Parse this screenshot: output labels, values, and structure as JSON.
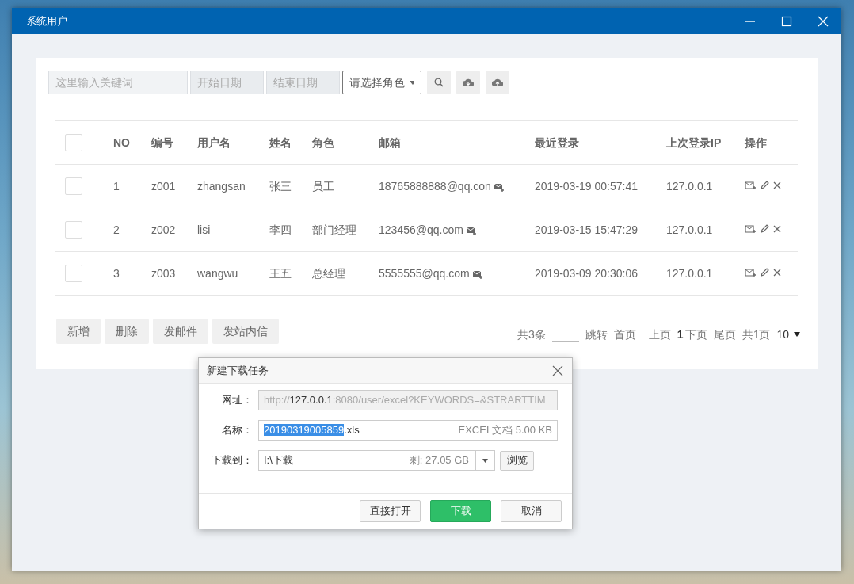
{
  "window": {
    "title": "系统用户"
  },
  "toolbar": {
    "keyword": {
      "placeholder": "这里输入关键词"
    },
    "start_date": {
      "placeholder": "开始日期"
    },
    "end_date": {
      "placeholder": "结束日期"
    },
    "role_select": {
      "value": "请选择角色"
    }
  },
  "table": {
    "header_checked": false,
    "columns": [
      "NO",
      "编号",
      "用户名",
      "姓名",
      "角色",
      "邮箱",
      "最近登录",
      "上次登录IP",
      "操作"
    ],
    "rows": [
      {
        "checked": false,
        "no": "1",
        "code": "z001",
        "username": "zhangsan",
        "name": "张三",
        "role": "员工",
        "email": "18765888888@qq.con",
        "last_login": "2019-03-19 00:57:41",
        "ip": "127.0.0.1"
      },
      {
        "checked": false,
        "no": "2",
        "code": "z002",
        "username": "lisi",
        "name": "李四",
        "role": "部门经理",
        "email": "123456@qq.com",
        "last_login": "2019-03-15 15:47:29",
        "ip": "127.0.0.1"
      },
      {
        "checked": false,
        "no": "3",
        "code": "z003",
        "username": "wangwu",
        "name": "王五",
        "role": "总经理",
        "email": "5555555@qq.com",
        "last_login": "2019-03-09 20:30:06",
        "ip": "127.0.0.1"
      }
    ]
  },
  "actions": [
    "新增",
    "删除",
    "发邮件",
    "发站内信"
  ],
  "pagination": {
    "total": "共3条",
    "jump": "跳转",
    "first": "首页",
    "prev": "上页",
    "current": "1",
    "next": "下页",
    "last": "尾页",
    "pages": "共1页",
    "page_size": "10"
  },
  "dialog": {
    "title": "新建下载任务",
    "url_label": "网址：",
    "url": "http://**127.0.0.1**:8080/user/excel?KEYWORDS=&STRARTTIM",
    "name_label": "名称：",
    "filename": "**20190319005859**.xls",
    "file_info": "EXCEL文档 5.00 KB",
    "dest_label": "下载到：",
    "dest": "I:\\下载",
    "free_space": "剩: 27.05 GB",
    "browse": "浏览",
    "buttons": [
      {
        "label": "直接打开",
        "kind": "default"
      },
      {
        "label": "下载",
        "kind": "primary"
      },
      {
        "label": "取消",
        "kind": "default"
      }
    ]
  }
}
